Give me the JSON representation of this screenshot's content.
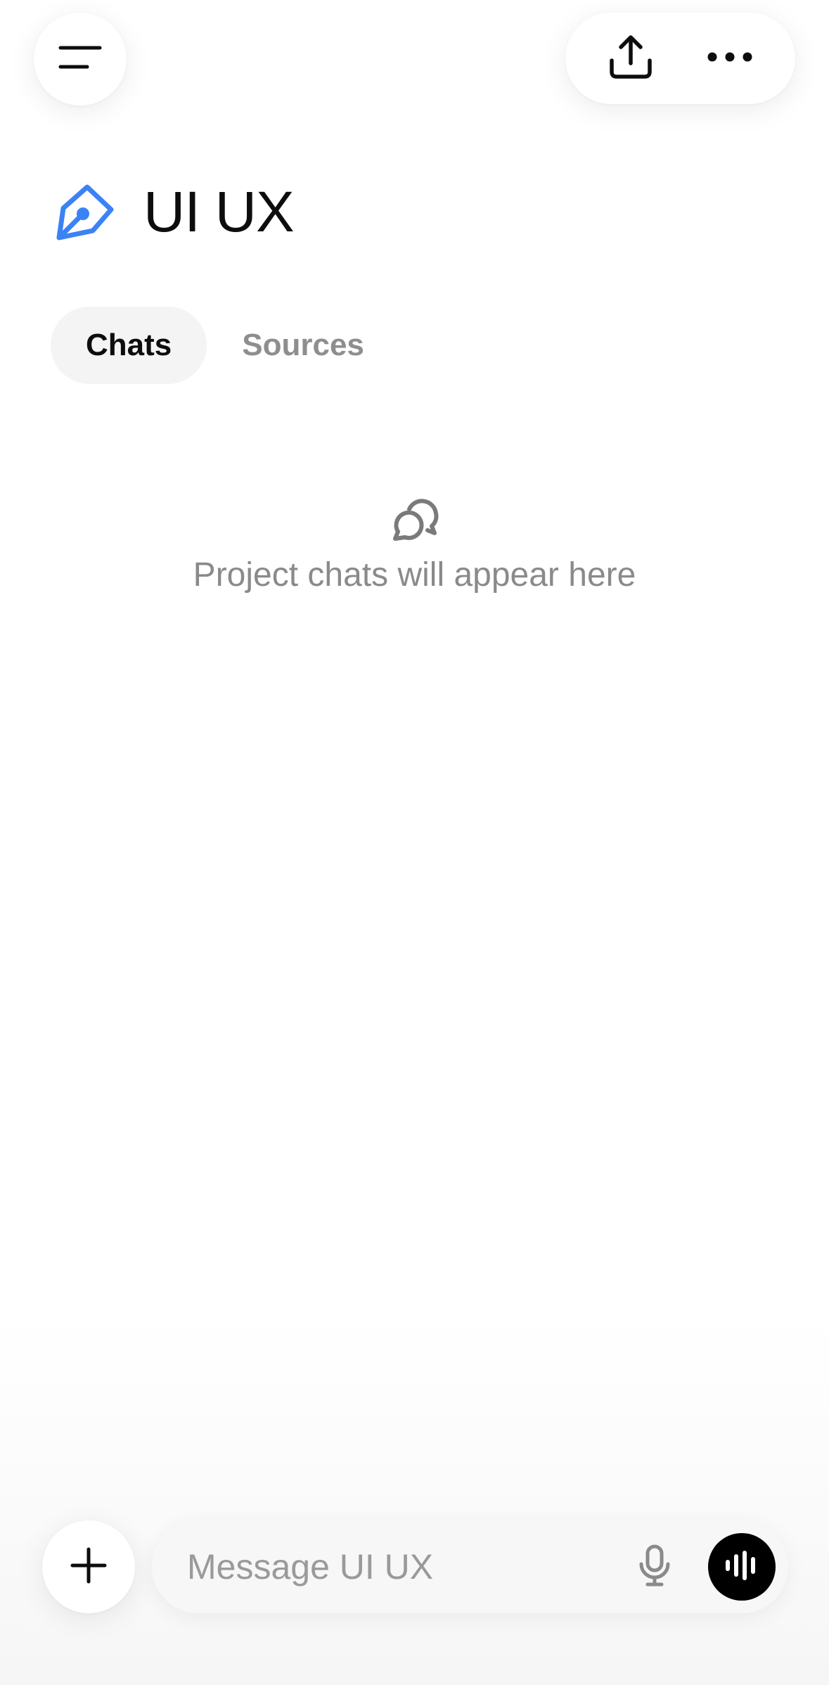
{
  "header": {
    "menu_icon": "menu-icon",
    "share_icon": "share-upload-icon",
    "more_icon": "more-dots-icon"
  },
  "project": {
    "title": "UI UX",
    "icon": "pen-nib-icon",
    "icon_color": "#3b82f6"
  },
  "tabs": [
    {
      "label": "Chats",
      "active": true
    },
    {
      "label": "Sources",
      "active": false
    }
  ],
  "empty_state": {
    "icon": "chat-bubbles-icon",
    "text": "Project chats will appear here"
  },
  "composer": {
    "add_icon": "plus-icon",
    "placeholder": "Message UI UX",
    "value": "",
    "mic_icon": "microphone-icon",
    "voice_icon": "voice-waveform-icon"
  },
  "colors": {
    "text_primary": "#0d0d0d",
    "text_muted": "#8e8e8e",
    "tab_active_bg": "#f4f4f4",
    "accent": "#3b82f6"
  }
}
